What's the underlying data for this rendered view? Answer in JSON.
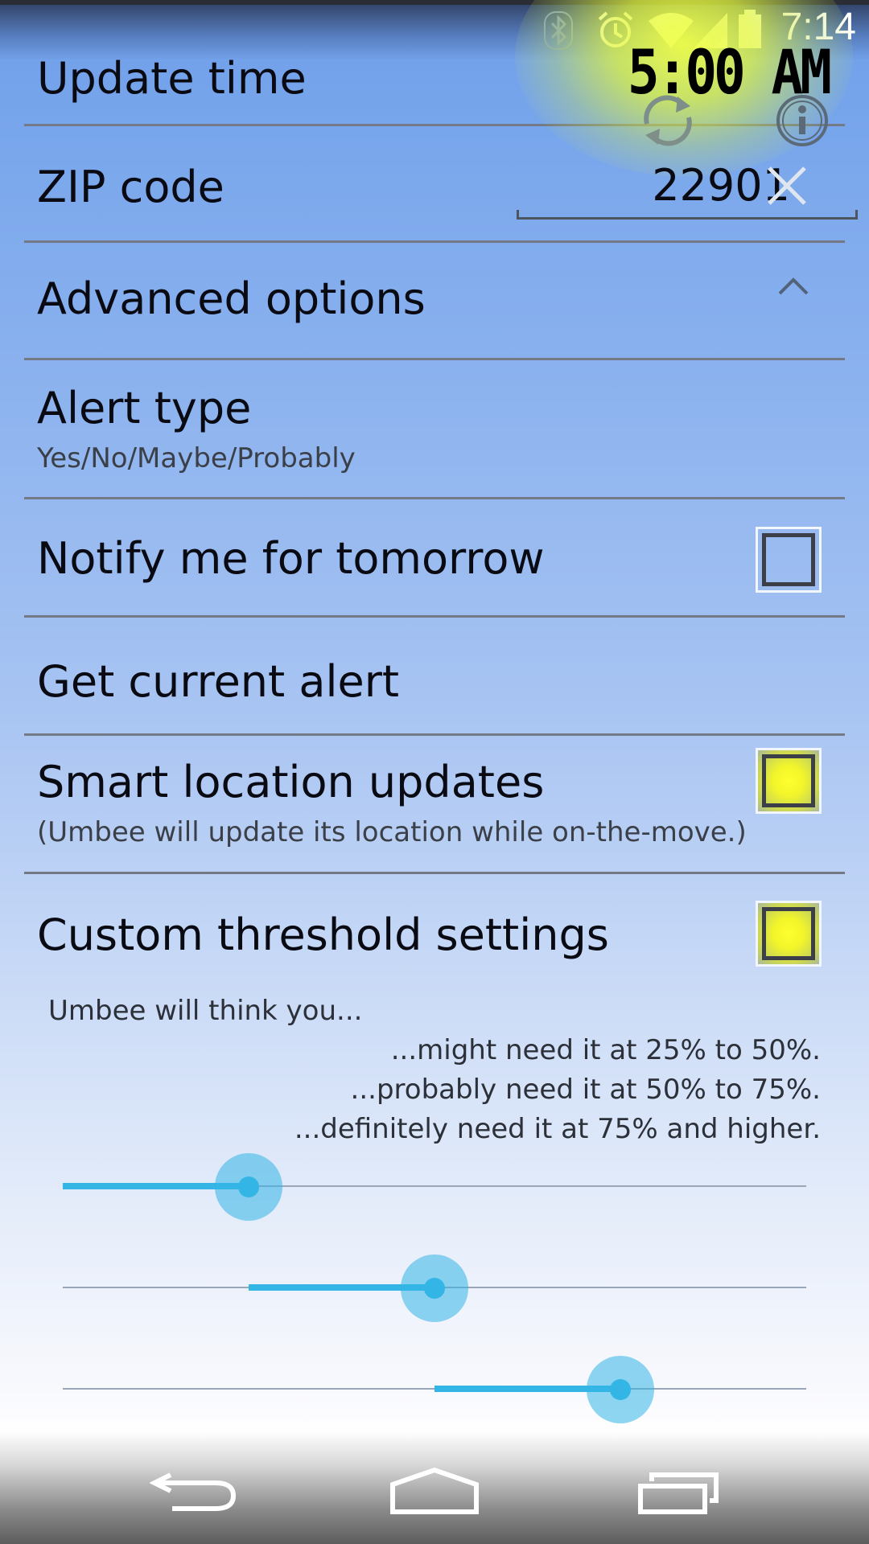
{
  "status_bar": {
    "time": "7:14",
    "icons": [
      "bluetooth-icon",
      "alarm-icon",
      "wifi-icon",
      "signal-icon",
      "battery-icon"
    ]
  },
  "header": {
    "update_time_label": "Update time",
    "update_time_value": "5:00 AM",
    "refresh_icon": "refresh-icon",
    "info_icon": "info-icon",
    "glow_color": "#f0ff46"
  },
  "zip": {
    "label": "ZIP code",
    "value": "22901",
    "clear_icon": "close-icon"
  },
  "advanced": {
    "label": "Advanced options",
    "expanded": true,
    "icon": "chevron-up-icon"
  },
  "alert_type": {
    "label": "Alert type",
    "value": "Yes/No/Maybe/Probably"
  },
  "notify_tomorrow": {
    "label": "Notify me for tomorrow",
    "checked": false
  },
  "current_alert": {
    "label": "Get current alert"
  },
  "smart_location": {
    "label": "Smart location updates",
    "description": "(Umbee will update its location while on-the-move.)",
    "checked": true
  },
  "custom_threshold": {
    "label": "Custom threshold settings",
    "checked": true,
    "intro": "Umbee will think you...",
    "lines": [
      "...might need it at 25% to 50%.",
      "...probably need it at 50% to 75%.",
      "...definitely need it at 75% and higher."
    ],
    "sliders": [
      {
        "name": "might",
        "value": 25,
        "fill_from": 0
      },
      {
        "name": "probably",
        "value": 50,
        "fill_from": 25
      },
      {
        "name": "definitely",
        "value": 75,
        "fill_from": 50
      }
    ],
    "accent": "#33b5e5"
  },
  "nav": {
    "back_icon": "back-icon",
    "home_icon": "home-icon",
    "recents_icon": "recents-icon"
  }
}
